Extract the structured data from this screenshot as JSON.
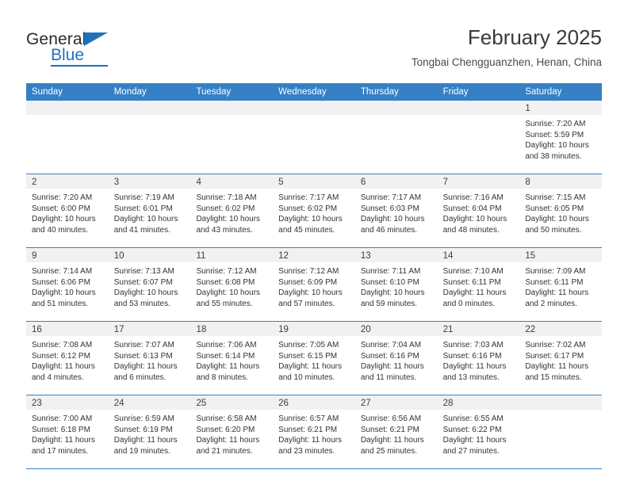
{
  "brand": {
    "word1": "General",
    "word2": "Blue"
  },
  "header": {
    "title": "February 2025",
    "subtitle": "Tongbai Chengguanzhen, Henan, China"
  },
  "colors": {
    "header_blue": "#3580c4",
    "brand_blue": "#1f72bd",
    "daynum_band": "#f1f1f1"
  },
  "weekdays": [
    "Sunday",
    "Monday",
    "Tuesday",
    "Wednesday",
    "Thursday",
    "Friday",
    "Saturday"
  ],
  "weeks": [
    [
      {
        "day": "",
        "sunrise": "",
        "sunset": "",
        "daylight": "",
        "empty": true
      },
      {
        "day": "",
        "sunrise": "",
        "sunset": "",
        "daylight": "",
        "empty": true
      },
      {
        "day": "",
        "sunrise": "",
        "sunset": "",
        "daylight": "",
        "empty": true
      },
      {
        "day": "",
        "sunrise": "",
        "sunset": "",
        "daylight": "",
        "empty": true
      },
      {
        "day": "",
        "sunrise": "",
        "sunset": "",
        "daylight": "",
        "empty": true
      },
      {
        "day": "",
        "sunrise": "",
        "sunset": "",
        "daylight": "",
        "empty": true
      },
      {
        "day": "1",
        "sunrise": "Sunrise: 7:20 AM",
        "sunset": "Sunset: 5:59 PM",
        "daylight": "Daylight: 10 hours and 38 minutes."
      }
    ],
    [
      {
        "day": "2",
        "sunrise": "Sunrise: 7:20 AM",
        "sunset": "Sunset: 6:00 PM",
        "daylight": "Daylight: 10 hours and 40 minutes."
      },
      {
        "day": "3",
        "sunrise": "Sunrise: 7:19 AM",
        "sunset": "Sunset: 6:01 PM",
        "daylight": "Daylight: 10 hours and 41 minutes."
      },
      {
        "day": "4",
        "sunrise": "Sunrise: 7:18 AM",
        "sunset": "Sunset: 6:02 PM",
        "daylight": "Daylight: 10 hours and 43 minutes."
      },
      {
        "day": "5",
        "sunrise": "Sunrise: 7:17 AM",
        "sunset": "Sunset: 6:02 PM",
        "daylight": "Daylight: 10 hours and 45 minutes."
      },
      {
        "day": "6",
        "sunrise": "Sunrise: 7:17 AM",
        "sunset": "Sunset: 6:03 PM",
        "daylight": "Daylight: 10 hours and 46 minutes."
      },
      {
        "day": "7",
        "sunrise": "Sunrise: 7:16 AM",
        "sunset": "Sunset: 6:04 PM",
        "daylight": "Daylight: 10 hours and 48 minutes."
      },
      {
        "day": "8",
        "sunrise": "Sunrise: 7:15 AM",
        "sunset": "Sunset: 6:05 PM",
        "daylight": "Daylight: 10 hours and 50 minutes."
      }
    ],
    [
      {
        "day": "9",
        "sunrise": "Sunrise: 7:14 AM",
        "sunset": "Sunset: 6:06 PM",
        "daylight": "Daylight: 10 hours and 51 minutes."
      },
      {
        "day": "10",
        "sunrise": "Sunrise: 7:13 AM",
        "sunset": "Sunset: 6:07 PM",
        "daylight": "Daylight: 10 hours and 53 minutes."
      },
      {
        "day": "11",
        "sunrise": "Sunrise: 7:12 AM",
        "sunset": "Sunset: 6:08 PM",
        "daylight": "Daylight: 10 hours and 55 minutes."
      },
      {
        "day": "12",
        "sunrise": "Sunrise: 7:12 AM",
        "sunset": "Sunset: 6:09 PM",
        "daylight": "Daylight: 10 hours and 57 minutes."
      },
      {
        "day": "13",
        "sunrise": "Sunrise: 7:11 AM",
        "sunset": "Sunset: 6:10 PM",
        "daylight": "Daylight: 10 hours and 59 minutes."
      },
      {
        "day": "14",
        "sunrise": "Sunrise: 7:10 AM",
        "sunset": "Sunset: 6:11 PM",
        "daylight": "Daylight: 11 hours and 0 minutes."
      },
      {
        "day": "15",
        "sunrise": "Sunrise: 7:09 AM",
        "sunset": "Sunset: 6:11 PM",
        "daylight": "Daylight: 11 hours and 2 minutes."
      }
    ],
    [
      {
        "day": "16",
        "sunrise": "Sunrise: 7:08 AM",
        "sunset": "Sunset: 6:12 PM",
        "daylight": "Daylight: 11 hours and 4 minutes."
      },
      {
        "day": "17",
        "sunrise": "Sunrise: 7:07 AM",
        "sunset": "Sunset: 6:13 PM",
        "daylight": "Daylight: 11 hours and 6 minutes."
      },
      {
        "day": "18",
        "sunrise": "Sunrise: 7:06 AM",
        "sunset": "Sunset: 6:14 PM",
        "daylight": "Daylight: 11 hours and 8 minutes."
      },
      {
        "day": "19",
        "sunrise": "Sunrise: 7:05 AM",
        "sunset": "Sunset: 6:15 PM",
        "daylight": "Daylight: 11 hours and 10 minutes."
      },
      {
        "day": "20",
        "sunrise": "Sunrise: 7:04 AM",
        "sunset": "Sunset: 6:16 PM",
        "daylight": "Daylight: 11 hours and 11 minutes."
      },
      {
        "day": "21",
        "sunrise": "Sunrise: 7:03 AM",
        "sunset": "Sunset: 6:16 PM",
        "daylight": "Daylight: 11 hours and 13 minutes."
      },
      {
        "day": "22",
        "sunrise": "Sunrise: 7:02 AM",
        "sunset": "Sunset: 6:17 PM",
        "daylight": "Daylight: 11 hours and 15 minutes."
      }
    ],
    [
      {
        "day": "23",
        "sunrise": "Sunrise: 7:00 AM",
        "sunset": "Sunset: 6:18 PM",
        "daylight": "Daylight: 11 hours and 17 minutes."
      },
      {
        "day": "24",
        "sunrise": "Sunrise: 6:59 AM",
        "sunset": "Sunset: 6:19 PM",
        "daylight": "Daylight: 11 hours and 19 minutes."
      },
      {
        "day": "25",
        "sunrise": "Sunrise: 6:58 AM",
        "sunset": "Sunset: 6:20 PM",
        "daylight": "Daylight: 11 hours and 21 minutes."
      },
      {
        "day": "26",
        "sunrise": "Sunrise: 6:57 AM",
        "sunset": "Sunset: 6:21 PM",
        "daylight": "Daylight: 11 hours and 23 minutes."
      },
      {
        "day": "27",
        "sunrise": "Sunrise: 6:56 AM",
        "sunset": "Sunset: 6:21 PM",
        "daylight": "Daylight: 11 hours and 25 minutes."
      },
      {
        "day": "28",
        "sunrise": "Sunrise: 6:55 AM",
        "sunset": "Sunset: 6:22 PM",
        "daylight": "Daylight: 11 hours and 27 minutes."
      },
      {
        "day": "",
        "sunrise": "",
        "sunset": "",
        "daylight": "",
        "empty": true
      }
    ]
  ]
}
